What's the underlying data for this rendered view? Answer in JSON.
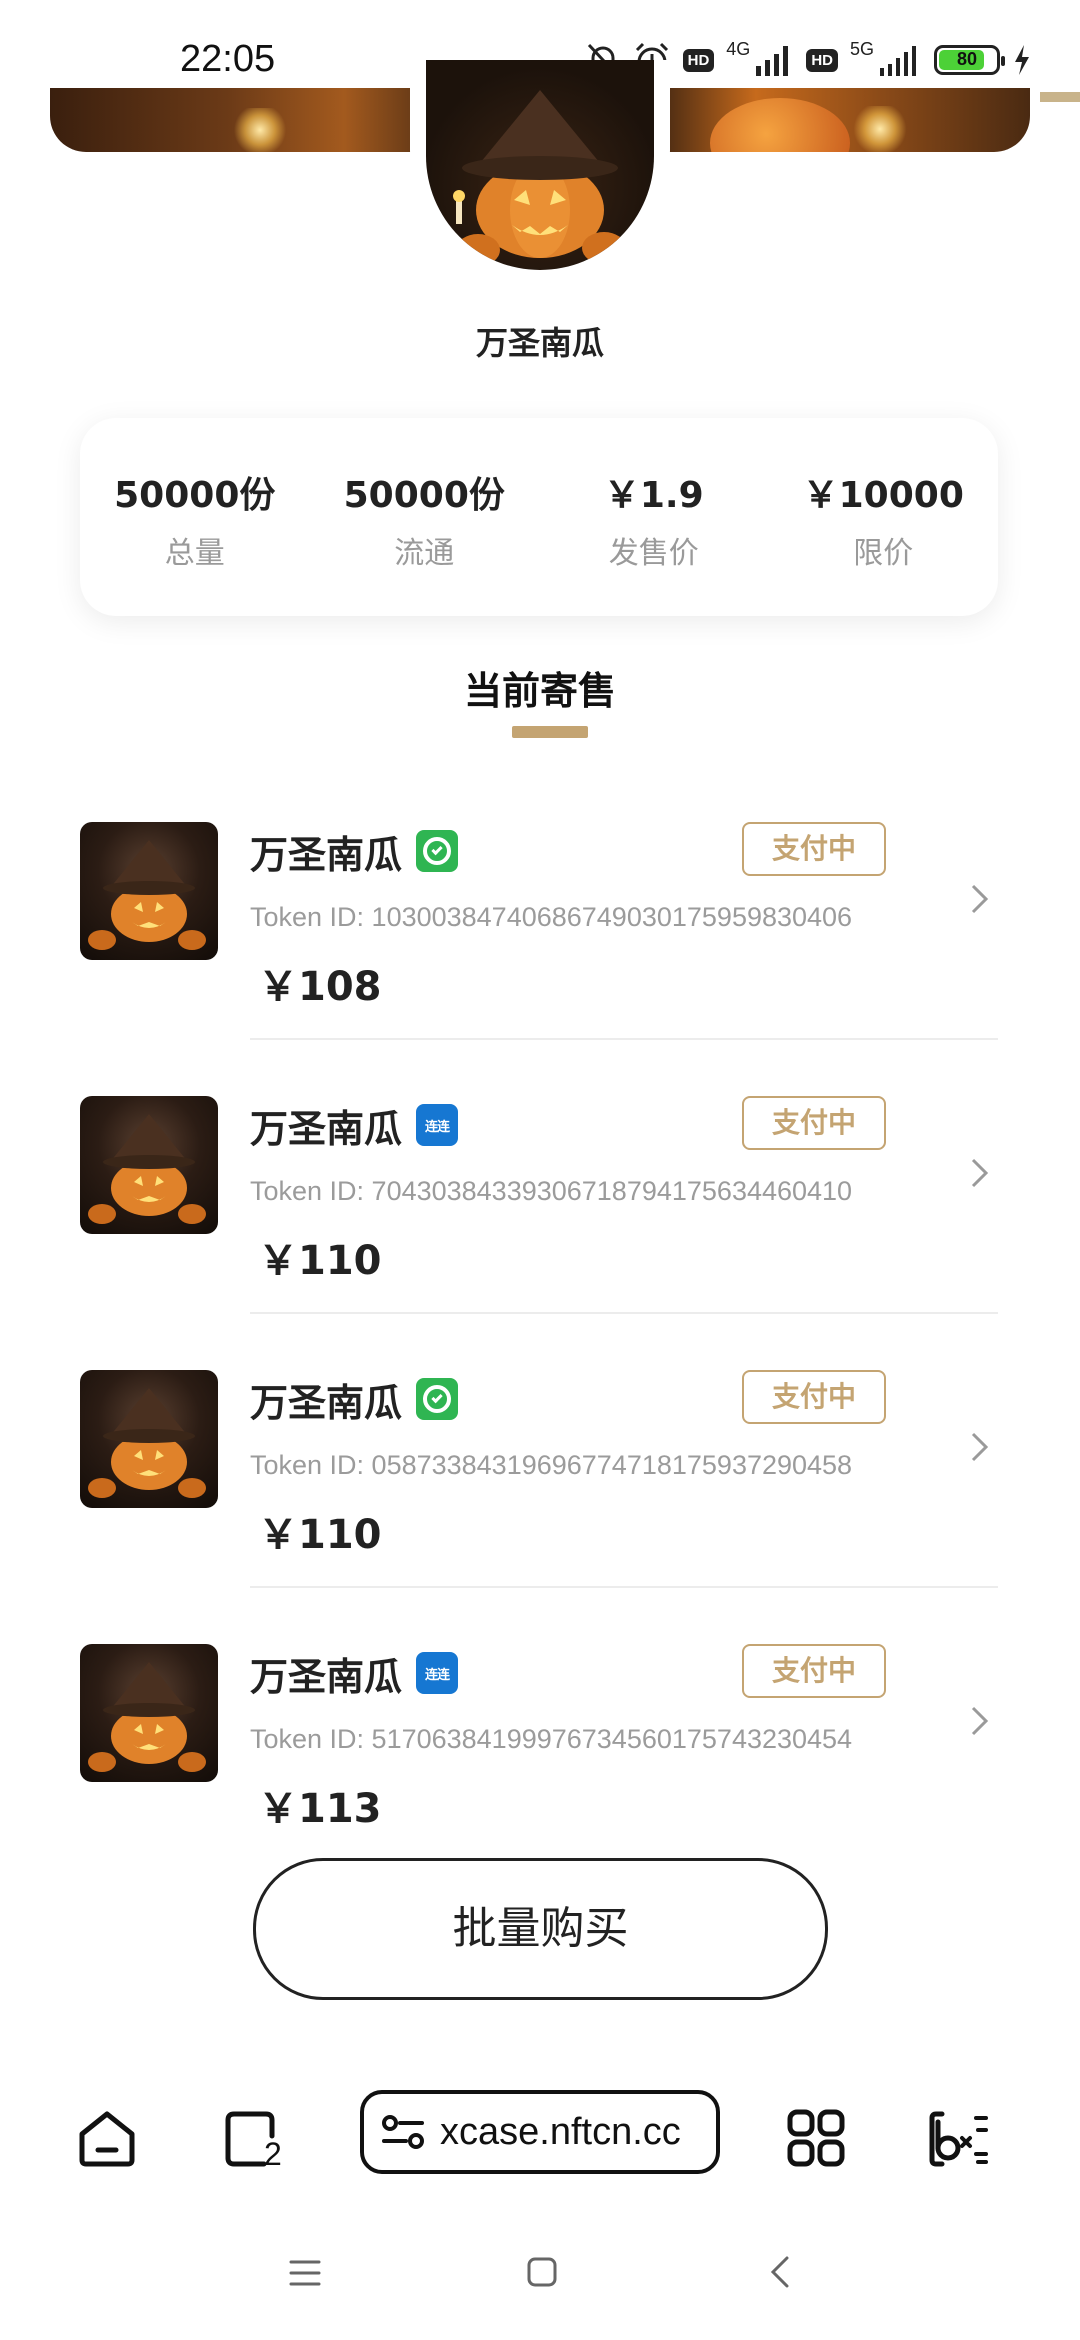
{
  "status_bar": {
    "time": "22:05",
    "network_1": "4G",
    "network_2": "5G",
    "hd_label": "HD",
    "battery": "80",
    "icons": [
      "mute-bell-icon",
      "alarm-icon",
      "signal-icon",
      "charging-icon"
    ]
  },
  "collection": {
    "name": "万圣南瓜"
  },
  "stats": [
    {
      "value": "50000份",
      "label": "总量"
    },
    {
      "value": "50000份",
      "label": "流通"
    },
    {
      "value": "￥1.9",
      "label": "发售价"
    },
    {
      "value": "￥10000",
      "label": "限价"
    }
  ],
  "tab": {
    "title": "当前寄售"
  },
  "listings": [
    {
      "name": "万圣南瓜",
      "chain": "green",
      "status": "支付中",
      "token_id": "Token ID: 1030038474068674903017595983040​6",
      "price": "￥108"
    },
    {
      "name": "万圣南瓜",
      "chain": "blue",
      "chain_label": "连连",
      "status": "支付中",
      "token_id": "Token ID: 7043038433930671879417563446041​0",
      "price": "￥110"
    },
    {
      "name": "万圣南瓜",
      "chain": "green",
      "status": "支付中",
      "token_id": "Token ID: 0587338431969677471817593729045​8",
      "price": "￥110"
    },
    {
      "name": "万圣南瓜",
      "chain": "blue",
      "chain_label": "连连",
      "status": "支付中",
      "token_id": "Token ID: 5170638419997673456017574323045​4",
      "price": "￥113"
    }
  ],
  "bulk_buy_label": "批量购买",
  "browser": {
    "url": "xcase.nftcn.cc",
    "tab_count": "2"
  },
  "colors": {
    "accent_gold": "#c4a472",
    "chain_green": "#2fb552",
    "chain_blue": "#1677d2"
  }
}
